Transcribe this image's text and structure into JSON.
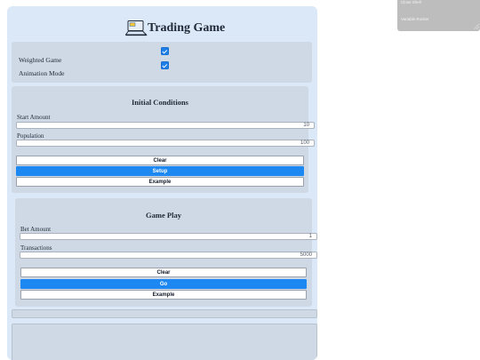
{
  "header": {
    "title": "Trading Game",
    "logo_icon": "monitor-icon"
  },
  "options": [
    {
      "label": "Weighted Game",
      "checked": true
    },
    {
      "label": "Animation Mode",
      "checked": true
    }
  ],
  "initial_conditions": {
    "title": "Initial Conditions",
    "start_amount_label": "Start Amount",
    "start_amount_value": "10",
    "population_label": "Population",
    "population_value": "100",
    "buttons": {
      "clear": "Clear",
      "setup": "Setup",
      "example": "Example"
    }
  },
  "game_play": {
    "title": "Game Play",
    "bet_amount_label": "Bet Amount",
    "bet_amount_value": "1",
    "transactions_label": "Transactions",
    "transactions_value": "5000",
    "buttons": {
      "clear": "Clear",
      "go": "Go",
      "example": "Example"
    }
  },
  "mini_panel": {
    "items": [
      "Close Shell",
      "Variable Rocket"
    ]
  },
  "colors": {
    "app_background": "#dbe8f7",
    "panel": "#cfd9e5",
    "primary_button": "#1e88f2",
    "checkbox": "#1d7ee8"
  }
}
